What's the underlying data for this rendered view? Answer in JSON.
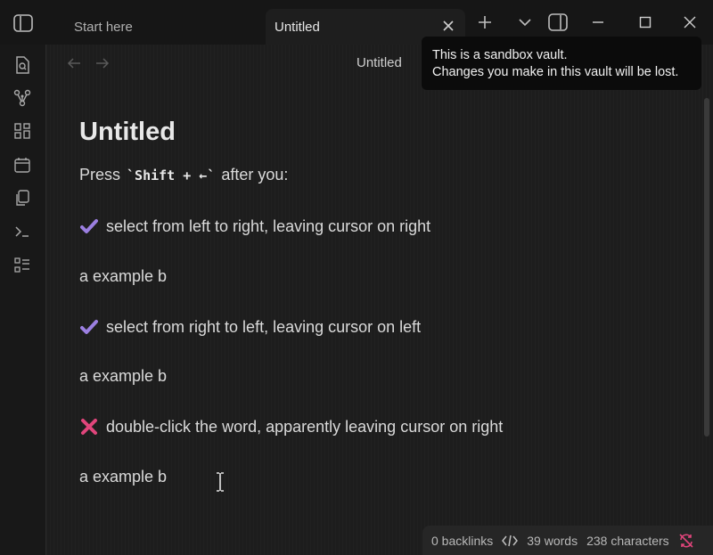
{
  "tabs": [
    {
      "label": "Start here"
    },
    {
      "label": "Untitled"
    }
  ],
  "view": {
    "title": "Untitled"
  },
  "tooltip": {
    "line1": "This is a sandbox vault.",
    "line2": "Changes you make in this vault will be lost."
  },
  "note": {
    "title": "Untitled",
    "press_prefix": "Press",
    "press_code": "`Shift + ←`",
    "press_suffix": "after you:",
    "items": [
      {
        "mark": "check",
        "text": "select from left to right, leaving cursor on right",
        "example": "a example b"
      },
      {
        "mark": "check",
        "text": "select from right to left, leaving cursor on left",
        "example": "a example b"
      },
      {
        "mark": "cross",
        "text": "double-click the word, apparently leaving cursor on right",
        "example": "a example b"
      }
    ]
  },
  "status": {
    "backlinks": "0 backlinks",
    "words": "39 words",
    "characters": "238 characters"
  },
  "colors": {
    "check": "#9b7fe0",
    "cross": "#e0457b",
    "sync_error": "#e0457b"
  }
}
